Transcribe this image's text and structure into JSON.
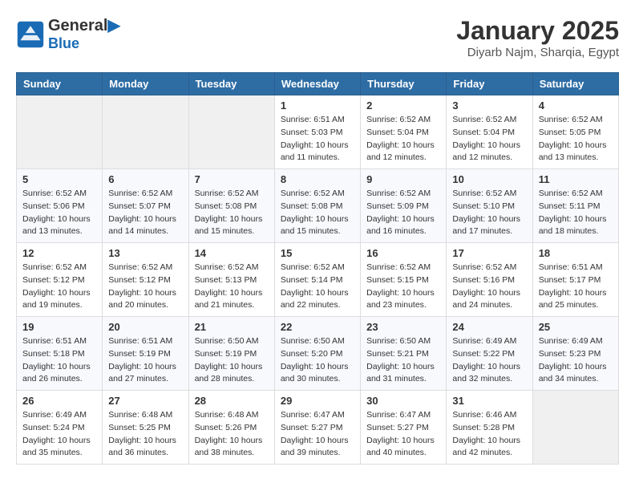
{
  "header": {
    "logo_line1": "General",
    "logo_line2": "Blue",
    "month_title": "January 2025",
    "location": "Diyarb Najm, Sharqia, Egypt"
  },
  "days_of_week": [
    "Sunday",
    "Monday",
    "Tuesday",
    "Wednesday",
    "Thursday",
    "Friday",
    "Saturday"
  ],
  "weeks": [
    [
      {
        "day": "",
        "sunrise": "",
        "sunset": "",
        "daylight": ""
      },
      {
        "day": "",
        "sunrise": "",
        "sunset": "",
        "daylight": ""
      },
      {
        "day": "",
        "sunrise": "",
        "sunset": "",
        "daylight": ""
      },
      {
        "day": "1",
        "sunrise": "Sunrise: 6:51 AM",
        "sunset": "Sunset: 5:03 PM",
        "daylight": "Daylight: 10 hours and 11 minutes."
      },
      {
        "day": "2",
        "sunrise": "Sunrise: 6:52 AM",
        "sunset": "Sunset: 5:04 PM",
        "daylight": "Daylight: 10 hours and 12 minutes."
      },
      {
        "day": "3",
        "sunrise": "Sunrise: 6:52 AM",
        "sunset": "Sunset: 5:04 PM",
        "daylight": "Daylight: 10 hours and 12 minutes."
      },
      {
        "day": "4",
        "sunrise": "Sunrise: 6:52 AM",
        "sunset": "Sunset: 5:05 PM",
        "daylight": "Daylight: 10 hours and 13 minutes."
      }
    ],
    [
      {
        "day": "5",
        "sunrise": "Sunrise: 6:52 AM",
        "sunset": "Sunset: 5:06 PM",
        "daylight": "Daylight: 10 hours and 13 minutes."
      },
      {
        "day": "6",
        "sunrise": "Sunrise: 6:52 AM",
        "sunset": "Sunset: 5:07 PM",
        "daylight": "Daylight: 10 hours and 14 minutes."
      },
      {
        "day": "7",
        "sunrise": "Sunrise: 6:52 AM",
        "sunset": "Sunset: 5:08 PM",
        "daylight": "Daylight: 10 hours and 15 minutes."
      },
      {
        "day": "8",
        "sunrise": "Sunrise: 6:52 AM",
        "sunset": "Sunset: 5:08 PM",
        "daylight": "Daylight: 10 hours and 15 minutes."
      },
      {
        "day": "9",
        "sunrise": "Sunrise: 6:52 AM",
        "sunset": "Sunset: 5:09 PM",
        "daylight": "Daylight: 10 hours and 16 minutes."
      },
      {
        "day": "10",
        "sunrise": "Sunrise: 6:52 AM",
        "sunset": "Sunset: 5:10 PM",
        "daylight": "Daylight: 10 hours and 17 minutes."
      },
      {
        "day": "11",
        "sunrise": "Sunrise: 6:52 AM",
        "sunset": "Sunset: 5:11 PM",
        "daylight": "Daylight: 10 hours and 18 minutes."
      }
    ],
    [
      {
        "day": "12",
        "sunrise": "Sunrise: 6:52 AM",
        "sunset": "Sunset: 5:12 PM",
        "daylight": "Daylight: 10 hours and 19 minutes."
      },
      {
        "day": "13",
        "sunrise": "Sunrise: 6:52 AM",
        "sunset": "Sunset: 5:12 PM",
        "daylight": "Daylight: 10 hours and 20 minutes."
      },
      {
        "day": "14",
        "sunrise": "Sunrise: 6:52 AM",
        "sunset": "Sunset: 5:13 PM",
        "daylight": "Daylight: 10 hours and 21 minutes."
      },
      {
        "day": "15",
        "sunrise": "Sunrise: 6:52 AM",
        "sunset": "Sunset: 5:14 PM",
        "daylight": "Daylight: 10 hours and 22 minutes."
      },
      {
        "day": "16",
        "sunrise": "Sunrise: 6:52 AM",
        "sunset": "Sunset: 5:15 PM",
        "daylight": "Daylight: 10 hours and 23 minutes."
      },
      {
        "day": "17",
        "sunrise": "Sunrise: 6:52 AM",
        "sunset": "Sunset: 5:16 PM",
        "daylight": "Daylight: 10 hours and 24 minutes."
      },
      {
        "day": "18",
        "sunrise": "Sunrise: 6:51 AM",
        "sunset": "Sunset: 5:17 PM",
        "daylight": "Daylight: 10 hours and 25 minutes."
      }
    ],
    [
      {
        "day": "19",
        "sunrise": "Sunrise: 6:51 AM",
        "sunset": "Sunset: 5:18 PM",
        "daylight": "Daylight: 10 hours and 26 minutes."
      },
      {
        "day": "20",
        "sunrise": "Sunrise: 6:51 AM",
        "sunset": "Sunset: 5:19 PM",
        "daylight": "Daylight: 10 hours and 27 minutes."
      },
      {
        "day": "21",
        "sunrise": "Sunrise: 6:50 AM",
        "sunset": "Sunset: 5:19 PM",
        "daylight": "Daylight: 10 hours and 28 minutes."
      },
      {
        "day": "22",
        "sunrise": "Sunrise: 6:50 AM",
        "sunset": "Sunset: 5:20 PM",
        "daylight": "Daylight: 10 hours and 30 minutes."
      },
      {
        "day": "23",
        "sunrise": "Sunrise: 6:50 AM",
        "sunset": "Sunset: 5:21 PM",
        "daylight": "Daylight: 10 hours and 31 minutes."
      },
      {
        "day": "24",
        "sunrise": "Sunrise: 6:49 AM",
        "sunset": "Sunset: 5:22 PM",
        "daylight": "Daylight: 10 hours and 32 minutes."
      },
      {
        "day": "25",
        "sunrise": "Sunrise: 6:49 AM",
        "sunset": "Sunset: 5:23 PM",
        "daylight": "Daylight: 10 hours and 34 minutes."
      }
    ],
    [
      {
        "day": "26",
        "sunrise": "Sunrise: 6:49 AM",
        "sunset": "Sunset: 5:24 PM",
        "daylight": "Daylight: 10 hours and 35 minutes."
      },
      {
        "day": "27",
        "sunrise": "Sunrise: 6:48 AM",
        "sunset": "Sunset: 5:25 PM",
        "daylight": "Daylight: 10 hours and 36 minutes."
      },
      {
        "day": "28",
        "sunrise": "Sunrise: 6:48 AM",
        "sunset": "Sunset: 5:26 PM",
        "daylight": "Daylight: 10 hours and 38 minutes."
      },
      {
        "day": "29",
        "sunrise": "Sunrise: 6:47 AM",
        "sunset": "Sunset: 5:27 PM",
        "daylight": "Daylight: 10 hours and 39 minutes."
      },
      {
        "day": "30",
        "sunrise": "Sunrise: 6:47 AM",
        "sunset": "Sunset: 5:27 PM",
        "daylight": "Daylight: 10 hours and 40 minutes."
      },
      {
        "day": "31",
        "sunrise": "Sunrise: 6:46 AM",
        "sunset": "Sunset: 5:28 PM",
        "daylight": "Daylight: 10 hours and 42 minutes."
      },
      {
        "day": "",
        "sunrise": "",
        "sunset": "",
        "daylight": ""
      }
    ]
  ]
}
